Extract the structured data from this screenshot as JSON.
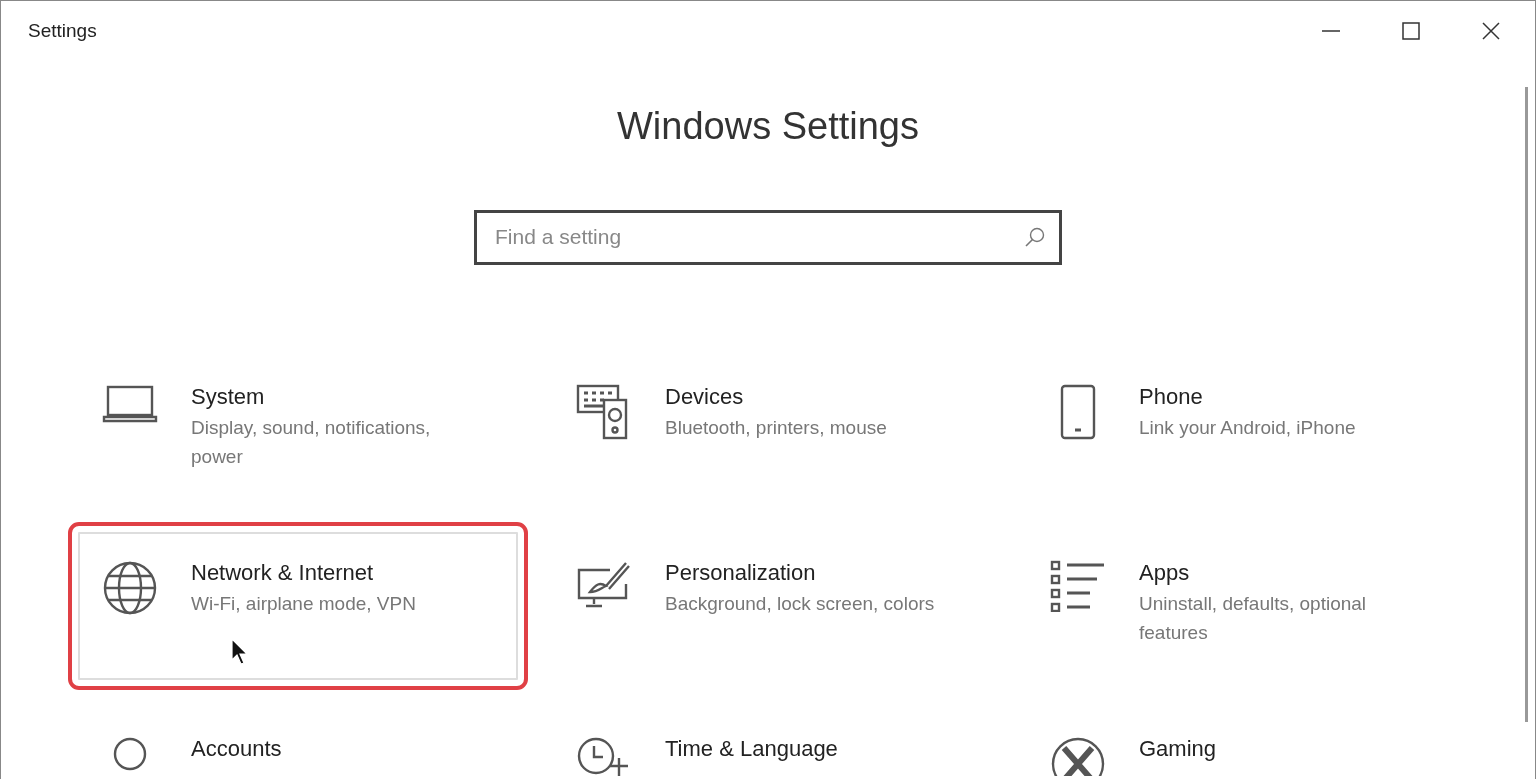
{
  "window": {
    "title": "Settings"
  },
  "heading": "Windows Settings",
  "search": {
    "placeholder": "Find a setting"
  },
  "categories": [
    {
      "title": "System",
      "description": "Display, sound, notifications, power",
      "highlighted": false
    },
    {
      "title": "Devices",
      "description": "Bluetooth, printers, mouse",
      "highlighted": false
    },
    {
      "title": "Phone",
      "description": "Link your Android, iPhone",
      "highlighted": false
    },
    {
      "title": "Network & Internet",
      "description": "Wi-Fi, airplane mode, VPN",
      "highlighted": true
    },
    {
      "title": "Personalization",
      "description": "Background, lock screen, colors",
      "highlighted": false
    },
    {
      "title": "Apps",
      "description": "Uninstall, defaults, optional features",
      "highlighted": false
    },
    {
      "title": "Accounts",
      "highlighted": false
    },
    {
      "title": "Time & Language",
      "highlighted": false
    },
    {
      "title": "Gaming",
      "highlighted": false
    }
  ]
}
